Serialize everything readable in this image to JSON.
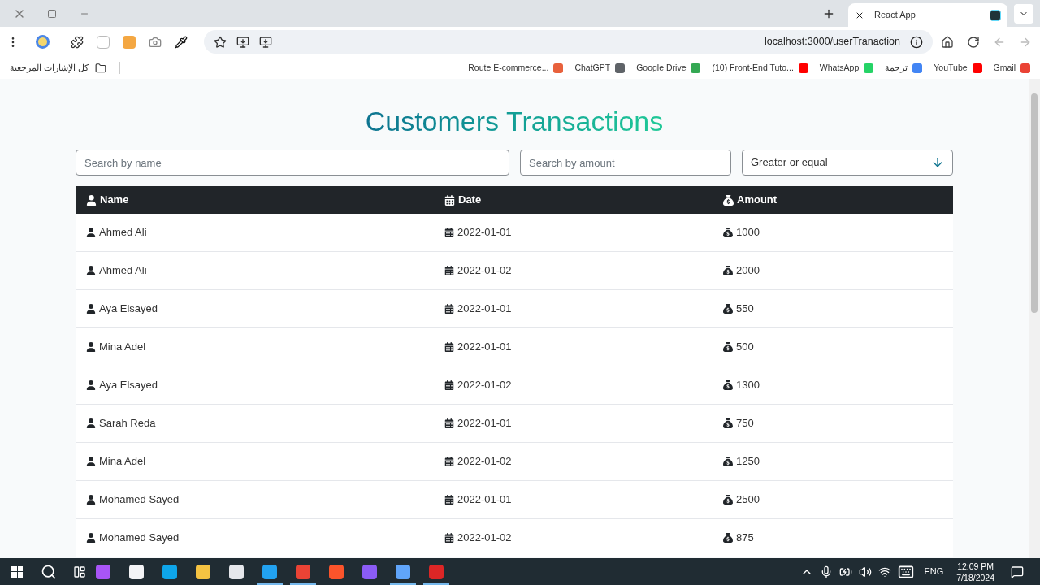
{
  "browser": {
    "tab": {
      "title": "React App"
    },
    "url": "localhost:3000/userTranaction",
    "all_bookmarks": "كل الإشارات المرجعية",
    "bookmarks": [
      {
        "label": "Route E-commerce...",
        "color": "#e8613c"
      },
      {
        "label": "ChatGPT",
        "color": "#5f6368"
      },
      {
        "label": "Google Drive",
        "color": "#34a853"
      },
      {
        "label": "(10) Front-End Tuto...",
        "color": "#ff0000"
      },
      {
        "label": "WhatsApp",
        "color": "#25d366"
      },
      {
        "label": "ترجمة",
        "color": "#4285f4"
      },
      {
        "label": "YouTube",
        "color": "#ff0000"
      },
      {
        "label": "Gmail",
        "color": "#ea4335"
      }
    ]
  },
  "page": {
    "title": "Customers Transactions",
    "search_name": {
      "placeholder": "Search by name"
    },
    "search_amount": {
      "placeholder": "Search by amount"
    },
    "filter": {
      "value": "Greater or equal"
    },
    "columns": [
      "Name",
      "Date",
      "Amount"
    ],
    "rows": [
      [
        "Ahmed Ali",
        "2022-01-01",
        "1000"
      ],
      [
        "Ahmed Ali",
        "2022-01-02",
        "2000"
      ],
      [
        "Aya Elsayed",
        "2022-01-01",
        "550"
      ],
      [
        "Mina Adel",
        "2022-01-01",
        "500"
      ],
      [
        "Aya Elsayed",
        "2022-01-02",
        "1300"
      ],
      [
        "Sarah Reda",
        "2022-01-01",
        "750"
      ],
      [
        "Mina Adel",
        "2022-01-02",
        "1250"
      ],
      [
        "Mohamed Sayed",
        "2022-01-01",
        "2500"
      ],
      [
        "Mohamed Sayed",
        "2022-01-02",
        "875"
      ]
    ]
  },
  "taskbar": {
    "apps": [
      {
        "color": "#a855f7",
        "running": false
      },
      {
        "color": "#f3f4f6",
        "running": false
      },
      {
        "color": "#0ea5e9",
        "running": false
      },
      {
        "color": "#f5c342",
        "running": false
      },
      {
        "color": "#e5e7eb",
        "running": false
      },
      {
        "color": "#22a2f0",
        "running": true
      },
      {
        "color": "#ea4335",
        "running": true
      },
      {
        "color": "#fb542b",
        "running": false
      },
      {
        "color": "#8b5cf6",
        "running": false
      },
      {
        "color": "#60a5fa",
        "running": true
      },
      {
        "color": "#dc2626",
        "running": true
      }
    ],
    "language": "ENG",
    "time": "12:09 PM",
    "date": "7/18/2024"
  }
}
